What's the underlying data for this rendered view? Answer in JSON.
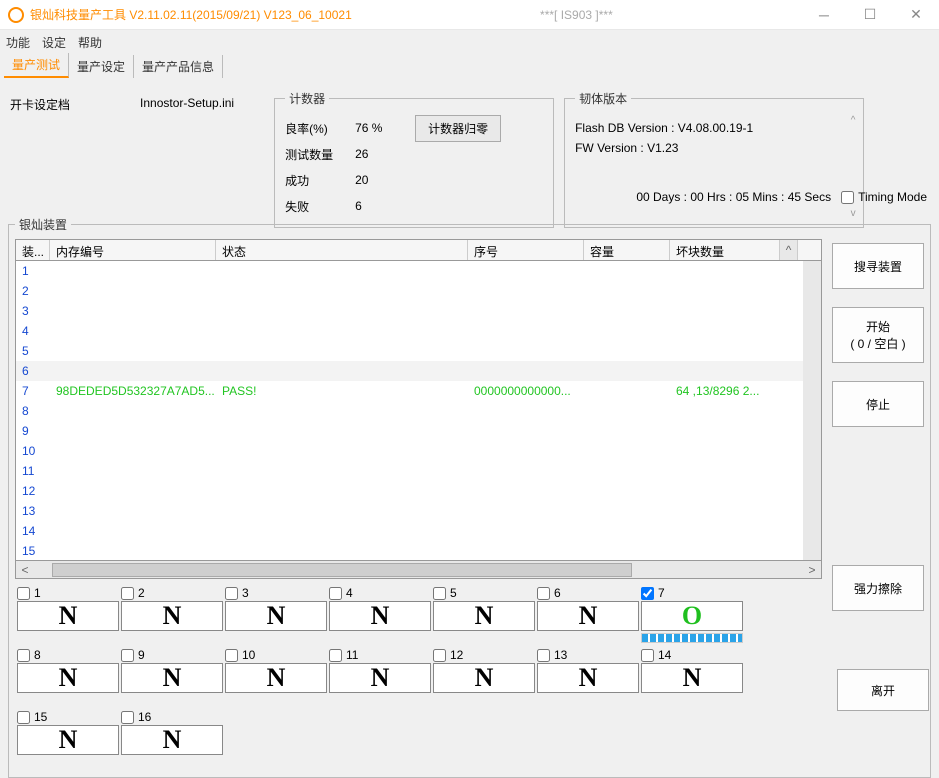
{
  "title": "银灿科技量产工具 V2.11.02.11(2015/09/21)     V123_06_10021",
  "title_mid": "***[ IS903 ]***",
  "menu": {
    "func": "功能",
    "settings": "设定",
    "help": "帮助"
  },
  "tabs": {
    "test": "量产测试",
    "set": "量产设定",
    "info": "量产产品信息"
  },
  "card_label": "开卡设定档",
  "setup_file": "Innostor-Setup.ini",
  "counters": {
    "legend": "计数器",
    "yield_lbl": "良率(%)",
    "yield_val": "76 %",
    "tested_lbl": "测试数量",
    "tested_val": "26",
    "pass_lbl": "成功",
    "pass_val": "20",
    "fail_lbl": "失败",
    "fail_val": "6",
    "reset_btn": "计数器归零"
  },
  "fw": {
    "legend": "韧体版本",
    "flashdb": "Flash DB Version :   V4.08.00.19-1",
    "fwver": "FW Version :    V1.23"
  },
  "elapsed": "00 Days : 00 Hrs : 05 Mins : 45 Secs",
  "timing_mode": "Timing Mode",
  "devices_legend": "银灿装置",
  "columns": {
    "c0": "装...",
    "c1": "内存编号",
    "c2": "状态",
    "c3": "序号",
    "c4": "容量",
    "c5": "坏块数量"
  },
  "rows": [
    {
      "n": "1"
    },
    {
      "n": "2"
    },
    {
      "n": "3"
    },
    {
      "n": "4"
    },
    {
      "n": "5"
    },
    {
      "n": "6",
      "hl": true
    },
    {
      "n": "7",
      "mem": "98DEDED5D532327A7AD5...",
      "state": "PASS!",
      "serial": "0000000000000...",
      "bad": "64 ,13/8296 2...",
      "green": true
    },
    {
      "n": "8"
    },
    {
      "n": "9"
    },
    {
      "n": "10"
    },
    {
      "n": "11"
    },
    {
      "n": "12"
    },
    {
      "n": "13"
    },
    {
      "n": "14"
    },
    {
      "n": "15"
    }
  ],
  "side": {
    "search": "搜寻装置",
    "start_l1": "开始",
    "start_l2": "(  0 /  空白  )",
    "stop": "停止",
    "erase": "强力擦除",
    "leave": "离开"
  },
  "slots": [
    {
      "n": "1",
      "chk": false,
      "s": "N"
    },
    {
      "n": "2",
      "chk": false,
      "s": "N"
    },
    {
      "n": "3",
      "chk": false,
      "s": "N"
    },
    {
      "n": "4",
      "chk": false,
      "s": "N"
    },
    {
      "n": "5",
      "chk": false,
      "s": "N"
    },
    {
      "n": "6",
      "chk": false,
      "s": "N"
    },
    {
      "n": "7",
      "chk": true,
      "s": "O",
      "green": true,
      "prog": true
    },
    {
      "n": "8",
      "chk": false,
      "s": "N"
    },
    {
      "n": "9",
      "chk": false,
      "s": "N"
    },
    {
      "n": "10",
      "chk": false,
      "s": "N"
    },
    {
      "n": "11",
      "chk": false,
      "s": "N"
    },
    {
      "n": "12",
      "chk": false,
      "s": "N"
    },
    {
      "n": "13",
      "chk": false,
      "s": "N"
    },
    {
      "n": "14",
      "chk": false,
      "s": "N"
    },
    {
      "n": "15",
      "chk": false,
      "s": "N"
    },
    {
      "n": "16",
      "chk": false,
      "s": "N"
    }
  ]
}
